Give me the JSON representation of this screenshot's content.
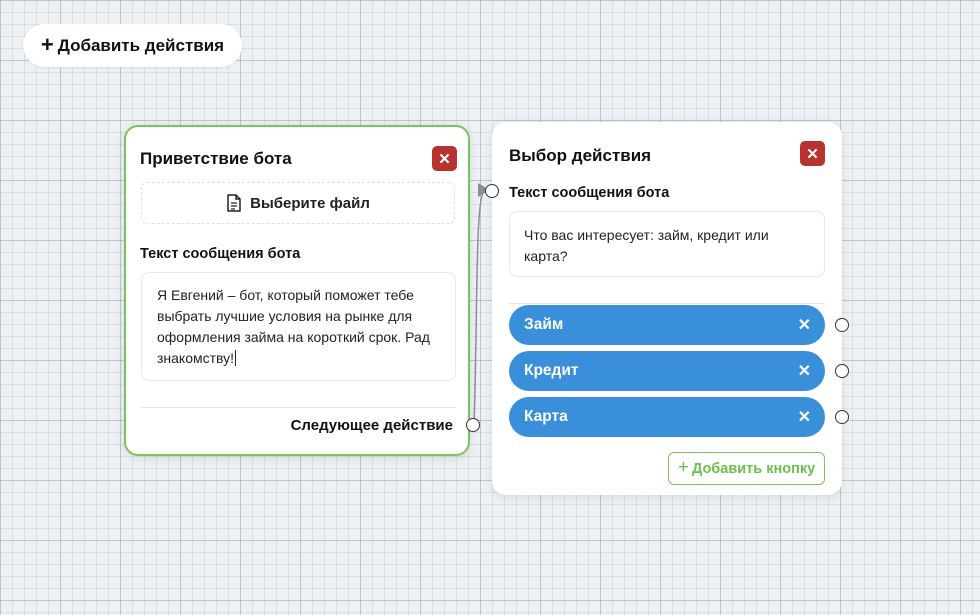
{
  "toolbar": {
    "add_action_label": "Добавить действия",
    "plus_glyph": "+"
  },
  "nodes": {
    "greeting": {
      "title": "Приветствие бота",
      "close_glyph": "✕",
      "file_picker_label": "Выберите файл",
      "file_icon": "file-icon",
      "text_label": "Текст сообщения бота",
      "message_text": "Я Евгений – бот, который поможет тебе выбрать лучшие условия на рынке для оформления займа на короткий срок. Рад знакомству!",
      "next_label": "Следующее действие",
      "border_color": "#7cc35c"
    },
    "choice": {
      "title": "Выбор действия",
      "close_glyph": "✕",
      "text_label": "Текст сообщения бота",
      "message_text": "Что вас интересует: займ, кредит или карта?",
      "buttons": [
        {
          "label": "Займ",
          "remove_glyph": "✕"
        },
        {
          "label": "Кредит",
          "remove_glyph": "✕"
        },
        {
          "label": "Карта",
          "remove_glyph": "✕"
        }
      ],
      "add_button_label": "Добавить кнопку",
      "add_button_glyph": "+"
    }
  },
  "colors": {
    "accent_green": "#7cc35c",
    "button_blue": "#3a8fdb",
    "close_red": "#b8332f",
    "canvas_bg": "#eef1f3"
  }
}
